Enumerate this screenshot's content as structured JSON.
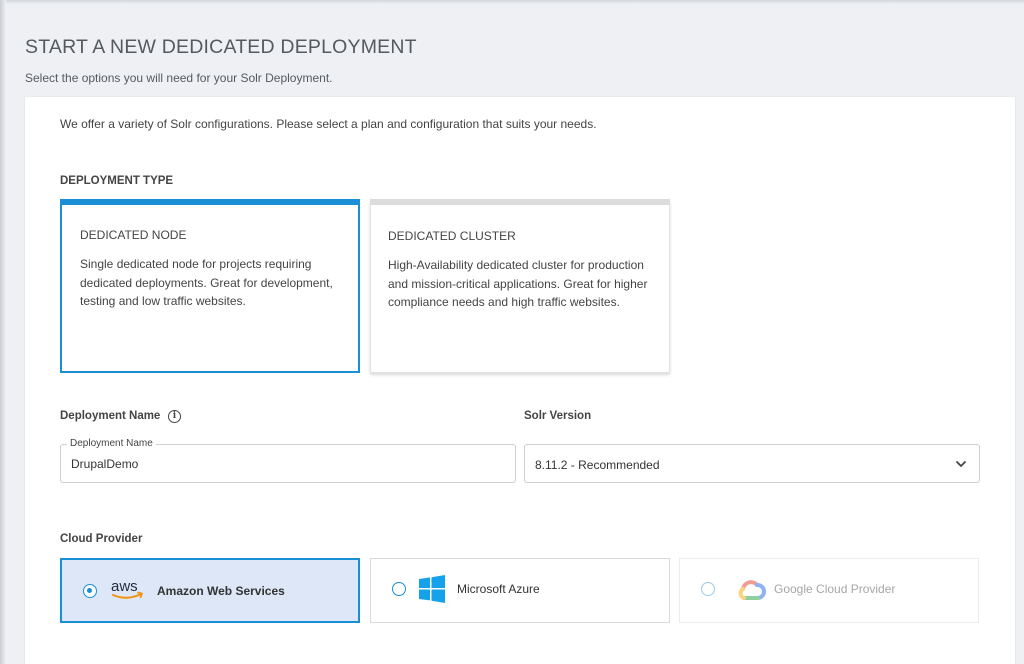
{
  "header": {
    "title": "START A NEW DEDICATED DEPLOYMENT",
    "subtitle": "Select the options you will need for your Solr Deployment."
  },
  "intro": "We offer a variety of Solr configurations. Please select a plan and configuration that suits your needs.",
  "deployment_type": {
    "label": "DEPLOYMENT TYPE",
    "options": [
      {
        "title": "DEDICATED NODE",
        "description": "Single dedicated node for projects requiring dedicated deployments. Great for development, testing and low traffic websites.",
        "selected": true
      },
      {
        "title": "DEDICATED CLUSTER",
        "description": "High-Availability dedicated cluster for production and mission-critical applications. Great for higher compliance needs and high traffic websites.",
        "selected": false
      }
    ]
  },
  "deployment_name": {
    "label": "Deployment Name",
    "field_label": "Deployment Name",
    "value": "DrupalDemo"
  },
  "solr_version": {
    "label": "Solr Version",
    "selected": "8.11.2 - Recommended"
  },
  "cloud_provider": {
    "label": "Cloud Provider",
    "options": [
      {
        "name": "Amazon Web Services",
        "logo": "aws-logo",
        "selected": true
      },
      {
        "name": "Microsoft Azure",
        "logo": "windows-logo",
        "selected": false
      },
      {
        "name": "Google Cloud Provider",
        "logo": "google-cloud-logo",
        "selected": false,
        "disabled": true
      }
    ]
  },
  "colors": {
    "accent": "#1a8fd6",
    "selected_bg": "#dde7f8",
    "page_bg": "#eef0f4"
  }
}
